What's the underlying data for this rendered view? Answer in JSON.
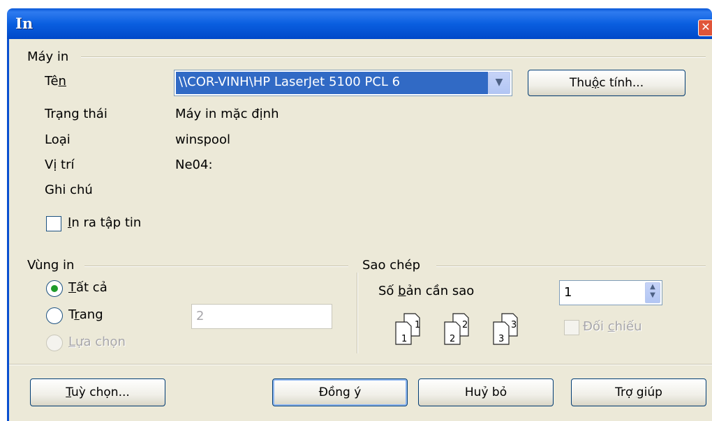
{
  "window": {
    "title": "In",
    "close_icon": "close-icon"
  },
  "printer_group": {
    "label": "Máy in",
    "name_label_pre": "Tê",
    "name_label_acc": "n",
    "name_label_post": "",
    "printer_value": "\\\\COR-VINH\\HP LaserJet 5100 PCL 6",
    "properties_pre": "Thu",
    "properties_acc": "ộ",
    "properties_post": "c tính...",
    "status_label": "Trạng thái",
    "status_value": "Máy in mặc định",
    "type_label": "Loại",
    "type_value": "winspool",
    "location_label": "Vị trí",
    "location_value": "Ne04:",
    "comment_label": "Ghi chú",
    "print_to_file_acc": "I",
    "print_to_file_post": "n ra tập tin"
  },
  "range_group": {
    "label": "Vùng in",
    "all_acc": "T",
    "all_post": "ất cả",
    "pages_pre": "T",
    "pages_acc": "r",
    "pages_post": "ang",
    "pages_value": "2",
    "selection_pre": "",
    "selection_acc": "L",
    "selection_post": "ựa chọn"
  },
  "copies_group": {
    "label": "Sao chép",
    "copies_label_pre": "Số ",
    "copies_label_acc": "b",
    "copies_label_post": "ản cần sao",
    "copies_value": "1",
    "collate_pre": "Đối ",
    "collate_acc": "c",
    "collate_post": "hiếu",
    "collate_icon_numbers": [
      "1",
      "1",
      "2",
      "2",
      "3",
      "3"
    ]
  },
  "buttons": {
    "options_acc": "T",
    "options_post": "uỳ chọn...",
    "ok": "Đồng ý",
    "cancel": "Huỷ bỏ",
    "help_pre": "Trợ ",
    "help_acc": "g",
    "help_post": "iúp"
  },
  "colors": {
    "titlebar": "#0a5fe0",
    "selection": "#316ac5",
    "dialog_bg": "#ece9d8"
  }
}
